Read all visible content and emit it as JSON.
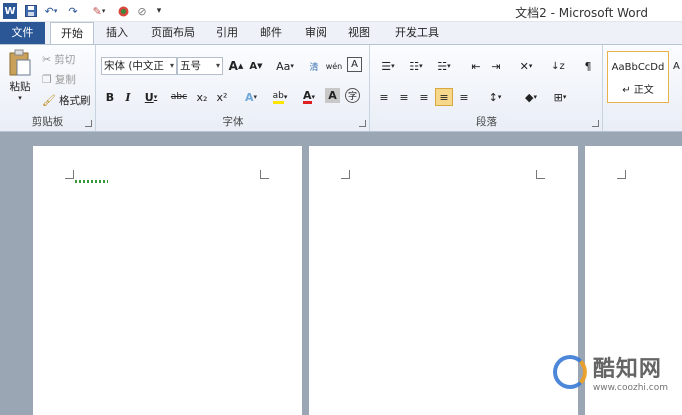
{
  "window": {
    "title": "文档2 - Microsoft Word"
  },
  "quick_access": {
    "word_icon": "W",
    "save_icon": "save-icon",
    "undo_icon": "undo-icon",
    "redo_icon": "redo-icon",
    "paint_icon": "brush-icon",
    "circle_icon": "circle-icon",
    "extra_icon": "draw-icon",
    "customize_icon": "customize-icon"
  },
  "tabs": [
    {
      "label": "文件"
    },
    {
      "label": "开始"
    },
    {
      "label": "插入"
    },
    {
      "label": "页面布局"
    },
    {
      "label": "引用"
    },
    {
      "label": "邮件"
    },
    {
      "label": "审阅"
    },
    {
      "label": "视图"
    },
    {
      "label": "开发工具"
    }
  ],
  "clipboard": {
    "paste_label": "粘贴",
    "cut_label": "剪切",
    "copy_label": "复制",
    "format_painter_label": "格式刷",
    "group_label": "剪贴板"
  },
  "font": {
    "font_name": "宋体 (中文正",
    "font_size": "五号",
    "grow": "A",
    "shrink": "A",
    "change_case": "Aa",
    "clear_format": "清",
    "phonetic": "wén",
    "border_char": "A",
    "bold": "B",
    "italic": "I",
    "underline": "U",
    "strike": "abc",
    "subscript": "x₂",
    "superscript": "x²",
    "text_effects": "A",
    "highlight": "ab",
    "font_color": "A",
    "char_shading": "A",
    "enclosed": "字",
    "group_label": "字体"
  },
  "paragraph": {
    "group_label": "段落"
  },
  "styles": {
    "sample": "AaBbCcDd",
    "name": "↵ 正文",
    "next_sample": "A"
  },
  "watermark": {
    "title": "酷知网",
    "url": "www.coozhi.com"
  },
  "colors": {
    "file_tab": "#2b5797",
    "highlight": "#ffe600",
    "font_color": "#e02020",
    "doc_bg": "#9ba6b5"
  }
}
